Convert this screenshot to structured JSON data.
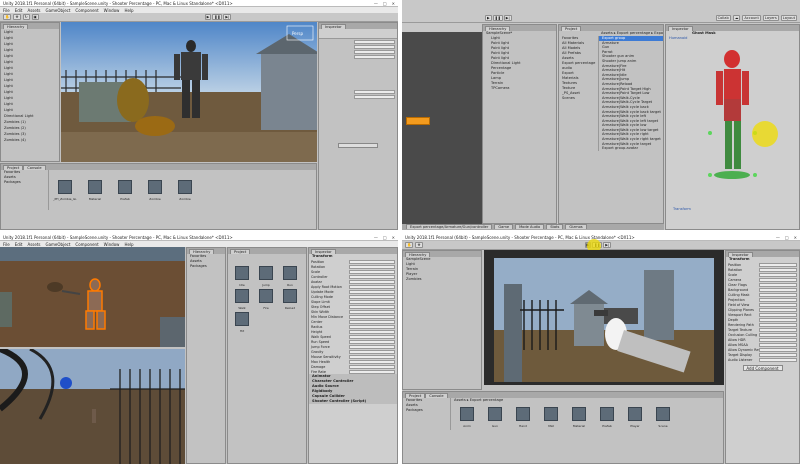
{
  "q1": {
    "title": "Unity 2018.1f1 Personal (64bit) - SampleScene.unity - Shooter Percentage - PC, Mac & Linux Standalone* <DX11>",
    "menu": [
      "File",
      "Edit",
      "Assets",
      "GameObject",
      "Component",
      "Window",
      "Help"
    ],
    "hierarchy_items": [
      "Light",
      "Light",
      "Light",
      "Light",
      "Light",
      "Light",
      "Light",
      "Light",
      "Light",
      "Light",
      "Light",
      "Light",
      "Light",
      "Light",
      "Directional Light",
      "Zombies (1)",
      "Zombies (2)",
      "Zombies (3)",
      "Zombies (4)"
    ],
    "project_tab": "Project",
    "console_tab": "Console",
    "project_folders": [
      "Favorites",
      "Assets",
      "Packages"
    ],
    "assets": [
      "_PH_Zombie_Gi...",
      "Material",
      "Prefab",
      "Zombie",
      "Zombie"
    ]
  },
  "q2": {
    "hierarchy_tab": "Hierarchy",
    "inspector_tab": "Inspector",
    "project_tab": "Project",
    "scene_root": "SampleScene*",
    "hierarchy_items": [
      "Light",
      "Point light",
      "Point light",
      "Point light",
      "Point light",
      "Directional Light",
      "Percentage",
      "Particle",
      "Lamp",
      "Terrain",
      "TPCamera"
    ],
    "collab": "Collab",
    "account": "Account",
    "layers": "Layers",
    "layout": "Layout",
    "breadcrumb": "Assets ▸ Export percentage ▸ Export",
    "favorites": [
      "Favorites",
      "All Materials",
      "All Models",
      "All Prefabs"
    ],
    "assets_folders": [
      "Assets",
      "Export percentage",
      "audio",
      "Export",
      "Materials",
      "Textures",
      "Texture",
      "_PS_Asset",
      "Scenes"
    ],
    "anim_items": [
      "Export group",
      "Armature",
      "Gun",
      "Parrot",
      "Shooter gun anim",
      "Shooter jump anim",
      "Armature|Fire",
      "Armature|Hit",
      "Armature|Idle",
      "Armature|Jump",
      "Armature|Reload",
      "Armature|Point Target High",
      "Armature|Point Target Low",
      "Armature|Walk-Cycle",
      "Armature|Walk-Cycle Target",
      "Armature|Walk cycle back",
      "Armature|Walk cycle back target",
      "Armature|Walk cycle left",
      "Armature|Walk cycle left target",
      "Armature|Walk cycle low",
      "Armature|Walk cycle low target",
      "Armature|Walk cycle right",
      "Armature|Walk cycle right target",
      "Armature|Walk cycle target",
      "Export group.avatar"
    ],
    "humanoid_label": "Humanoid",
    "ghost_mask": "Ghost Mask",
    "transform_label": "Transform",
    "footer_tabs": [
      "Export percentage/Armature/Gun/controller",
      "Game",
      "Mode Audio",
      "Stats",
      "Gizmos"
    ]
  },
  "q3": {
    "title": "Unity 2018.1f1 Personal (64bit) - SampleScene.unity - Shooter Percentage - PC, Mac & Linux Standalone* <DX11>",
    "inspector_header": "Transform",
    "component_sections": [
      "Animator",
      "Character Controller",
      "Audio Source",
      "Rigidbody",
      "Capsule Collider",
      "Shooter Controller (Script)"
    ],
    "fields": [
      "Position",
      "Rotation",
      "Scale",
      "Controller",
      "Avatar",
      "Apply Root Motion",
      "Update Mode",
      "Culling Mode",
      "Slope Limit",
      "Step Offset",
      "Skin Width",
      "Min Move Distance",
      "Center",
      "Radius",
      "Height",
      "Walk Speed",
      "Run Speed",
      "Jump Force",
      "Gravity",
      "Mouse Sensitivity",
      "Max Health",
      "Damage",
      "Fire Rate"
    ],
    "assets": [
      "Idle",
      "Jump",
      "Run",
      "Walk",
      "Fire",
      "Reload",
      "Hit"
    ]
  },
  "q4": {
    "hierarchy_items": [
      "SampleScene",
      "Light",
      "Terrain",
      "Player",
      "Zombies"
    ],
    "project_folders": [
      "Favorites",
      "Assets",
      "Packages"
    ],
    "breadcrumb": "Assets ▸ Export percentage",
    "assets": [
      "Anim",
      "Gun",
      "Hand",
      "Mat",
      "Material",
      "Prefab",
      "Player",
      "Scene"
    ],
    "inspector_title": "Transform",
    "inspector_fields": [
      "Position",
      "Rotation",
      "Scale",
      "Camera",
      "Clear Flags",
      "Background",
      "Culling Mask",
      "Projection",
      "Field of View",
      "Clipping Planes",
      "Viewport Rect",
      "Depth",
      "Rendering Path",
      "Target Texture",
      "Occlusion Culling",
      "Allow HDR",
      "Allow MSAA",
      "Allow Dynamic Resolution",
      "Target Display",
      "Audio Listener"
    ],
    "add_component": "Add Component"
  }
}
